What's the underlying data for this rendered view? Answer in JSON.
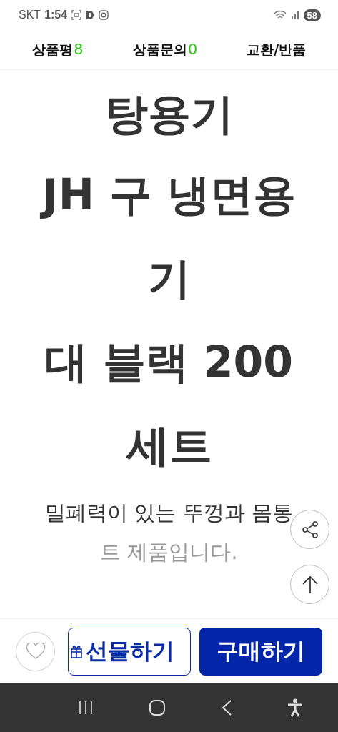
{
  "status_bar": {
    "carrier": "SKT",
    "time": "1:54",
    "battery": "58"
  },
  "tabs": [
    {
      "label": "상품평",
      "count": "8"
    },
    {
      "label": "상품문의",
      "count": "0"
    },
    {
      "label": "교환/반품"
    }
  ],
  "title_lines": [
    "탕용기",
    "JH 구 냉면용",
    "기",
    "대 블랙 200",
    "세트"
  ],
  "description_lines": [
    {
      "text": "밀폐력이 있는 뚜껑과 몸통",
      "faded": false
    },
    {
      "text": "트 제품입니다.",
      "faded": true
    }
  ],
  "bottom_bar": {
    "wish_selected": false,
    "gift_label": "선물하기",
    "buy_label": "구매하기"
  }
}
